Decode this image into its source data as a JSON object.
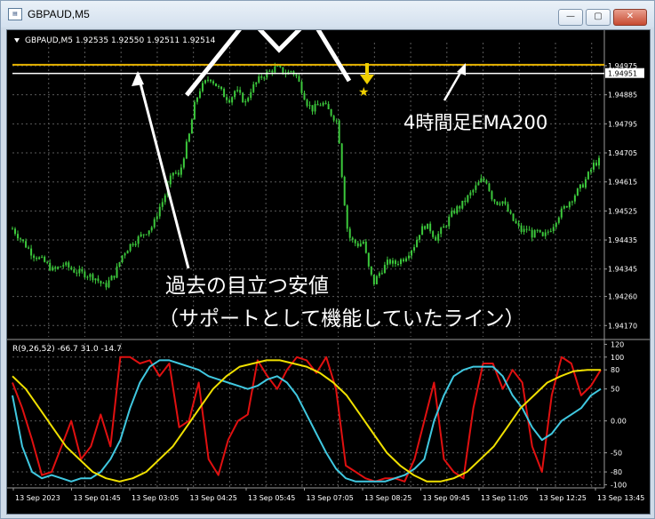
{
  "window": {
    "title": "GBPAUD,M5",
    "buttons": {
      "minimize": "—",
      "maximize": "▢",
      "close": "✕"
    }
  },
  "colors": {
    "background": "#000000",
    "grid": "#5a5a5a",
    "candle": "#3cc83c",
    "ema_line": "#e8b400",
    "white_line": "#ffffff",
    "red_line": "#e01010",
    "cyan_line": "#40c8e0",
    "yellow_line": "#f0e000",
    "marker": "#f0d000"
  },
  "chart_data": [
    {
      "type": "candlestick",
      "header": "GBPAUD,M5  1.92535 1.92550 1.92511 1.92514",
      "y_ticks": [
        "1.94975",
        "1.94885",
        "1.94795",
        "1.94705",
        "1.94615",
        "1.94525",
        "1.94435",
        "1.94345",
        "1.94260",
        "1.94170"
      ],
      "y_tick_values": [
        1.94975,
        1.94885,
        1.94795,
        1.94705,
        1.94615,
        1.94525,
        1.94435,
        1.94345,
        1.9426,
        1.9417
      ],
      "ylim": [
        1.94135,
        1.9503
      ],
      "price_label": "1.94951",
      "horizontal_lines": [
        {
          "label": "ema",
          "value": 1.94978
        },
        {
          "label": "price",
          "value": 1.94951
        }
      ],
      "close_path": [
        [
          0,
          1.9447
        ],
        [
          8,
          1.9443
        ],
        [
          16,
          1.9439
        ],
        [
          24,
          1.9437
        ],
        [
          32,
          1.9434
        ],
        [
          40,
          1.9436
        ],
        [
          48,
          1.9434
        ],
        [
          56,
          1.9433
        ],
        [
          64,
          1.9432
        ],
        [
          72,
          1.9429
        ],
        [
          80,
          1.9433
        ],
        [
          86,
          1.9439
        ],
        [
          92,
          1.9442
        ],
        [
          98,
          1.9444
        ],
        [
          104,
          1.9446
        ],
        [
          110,
          1.9448
        ],
        [
          114,
          1.9453
        ],
        [
          118,
          1.9456
        ],
        [
          122,
          1.9461
        ],
        [
          126,
          1.9465
        ],
        [
          130,
          1.9463
        ],
        [
          134,
          1.947
        ],
        [
          138,
          1.9476
        ],
        [
          142,
          1.9485
        ],
        [
          146,
          1.949
        ],
        [
          150,
          1.9492
        ],
        [
          154,
          1.9494
        ],
        [
          158,
          1.9492
        ],
        [
          162,
          1.949
        ],
        [
          166,
          1.9488
        ],
        [
          170,
          1.9487
        ],
        [
          174,
          1.949
        ],
        [
          178,
          1.9488
        ],
        [
          182,
          1.9486
        ],
        [
          186,
          1.949
        ],
        [
          190,
          1.9492
        ],
        [
          194,
          1.9494
        ],
        [
          198,
          1.9495
        ],
        [
          202,
          1.9496
        ],
        [
          206,
          1.9497
        ],
        [
          210,
          1.9496
        ],
        [
          214,
          1.9495
        ],
        [
          218,
          1.9496
        ],
        [
          222,
          1.9494
        ],
        [
          226,
          1.949
        ],
        [
          230,
          1.9486
        ],
        [
          234,
          1.9484
        ],
        [
          238,
          1.9485
        ],
        [
          242,
          1.9486
        ],
        [
          246,
          1.9484
        ],
        [
          250,
          1.9482
        ],
        [
          254,
          1.948
        ],
        [
          258,
          1.946
        ],
        [
          262,
          1.9445
        ],
        [
          266,
          1.9443
        ],
        [
          270,
          1.9442
        ],
        [
          274,
          1.9443
        ],
        [
          278,
          1.9435
        ],
        [
          282,
          1.943
        ],
        [
          286,
          1.9433
        ],
        [
          290,
          1.9435
        ],
        [
          294,
          1.9437
        ],
        [
          298,
          1.9436
        ],
        [
          302,
          1.9437
        ],
        [
          306,
          1.9438
        ],
        [
          310,
          1.944
        ],
        [
          314,
          1.9442
        ],
        [
          318,
          1.9446
        ],
        [
          322,
          1.9448
        ],
        [
          326,
          1.9447
        ],
        [
          330,
          1.9444
        ],
        [
          334,
          1.9446
        ],
        [
          338,
          1.9448
        ],
        [
          342,
          1.9451
        ],
        [
          346,
          1.9453
        ],
        [
          350,
          1.9454
        ],
        [
          354,
          1.9456
        ],
        [
          358,
          1.9458
        ],
        [
          362,
          1.946
        ],
        [
          366,
          1.9462
        ],
        [
          370,
          1.9462
        ],
        [
          374,
          1.9457
        ],
        [
          378,
          1.9455
        ],
        [
          382,
          1.9456
        ],
        [
          386,
          1.9453
        ],
        [
          390,
          1.945
        ],
        [
          394,
          1.9448
        ],
        [
          398,
          1.9446
        ],
        [
          402,
          1.9447
        ],
        [
          406,
          1.9445
        ],
        [
          410,
          1.9446
        ],
        [
          414,
          1.9444
        ],
        [
          418,
          1.9446
        ],
        [
          422,
          1.9448
        ],
        [
          426,
          1.9451
        ],
        [
          430,
          1.9453
        ],
        [
          434,
          1.9455
        ],
        [
          438,
          1.9457
        ],
        [
          442,
          1.9459
        ],
        [
          446,
          1.9461
        ],
        [
          450,
          1.9464
        ],
        [
          454,
          1.9467
        ],
        [
          458,
          1.9468
        ]
      ],
      "x_span": 458
    },
    {
      "type": "line",
      "header": "R(9,26,52) -66.7 31.0 -14.7",
      "y_ticks": [
        "120",
        "100",
        "80",
        "50",
        "0.00",
        "-50",
        "-80",
        "-100"
      ],
      "y_tick_values": [
        120,
        100,
        80,
        50,
        0,
        -50,
        -80,
        -100
      ],
      "ylim": [
        -105,
        122
      ],
      "x_ticks": [
        "13 Sep 2023",
        "13 Sep 01:45",
        "13 Sep 03:05",
        "13 Sep 04:25",
        "13 Sep 05:45",
        "13 Sep 07:05",
        "13 Sep 08:25",
        "13 Sep 09:45",
        "13 Sep 11:05",
        "13 Sep 12:25",
        "13 Sep 13:45"
      ],
      "series": [
        {
          "color": "#e01010",
          "values": [
            60,
            20,
            -30,
            -85,
            -80,
            -40,
            0,
            -60,
            -40,
            10,
            -40,
            100,
            100,
            90,
            95,
            70,
            90,
            -10,
            0,
            60,
            -60,
            -85,
            -30,
            0,
            10,
            95,
            70,
            50,
            80,
            100,
            95,
            75,
            100,
            50,
            -70,
            -80,
            -90,
            -95,
            -90,
            -90,
            -95,
            -60,
            0,
            60,
            -60,
            -80,
            -90,
            20,
            90,
            90,
            50,
            80,
            60,
            -40,
            -80,
            40,
            100,
            90,
            40,
            55,
            80
          ]
        },
        {
          "color": "#40c8e0",
          "values": [
            40,
            -40,
            -80,
            -90,
            -85,
            -90,
            -95,
            -90,
            -90,
            -80,
            -60,
            -30,
            20,
            60,
            85,
            95,
            95,
            90,
            85,
            80,
            70,
            65,
            60,
            55,
            50,
            55,
            65,
            70,
            60,
            40,
            10,
            -20,
            -50,
            -75,
            -90,
            -95,
            -95,
            -95,
            -95,
            -90,
            -85,
            -75,
            -60,
            0,
            40,
            70,
            80,
            85,
            85,
            85,
            70,
            40,
            20,
            -10,
            -30,
            -20,
            0,
            10,
            20,
            40,
            50
          ]
        },
        {
          "color": "#f0e000",
          "values": [
            70,
            50,
            20,
            -10,
            -40,
            -60,
            -80,
            -90,
            -95,
            -90,
            -80,
            -60,
            -40,
            -10,
            20,
            50,
            70,
            85,
            90,
            95,
            95,
            90,
            85,
            75,
            60,
            40,
            10,
            -20,
            -50,
            -70,
            -85,
            -95,
            -95,
            -90,
            -80,
            -60,
            -40,
            -10,
            20,
            40,
            60,
            70,
            78,
            80,
            80
          ]
        }
      ]
    }
  ],
  "annotations": {
    "ema_label": "4時間足EMA200",
    "support_label_line1": "過去の目立つ安値",
    "support_label_line2": "（サポートとして機能していたライン）"
  }
}
